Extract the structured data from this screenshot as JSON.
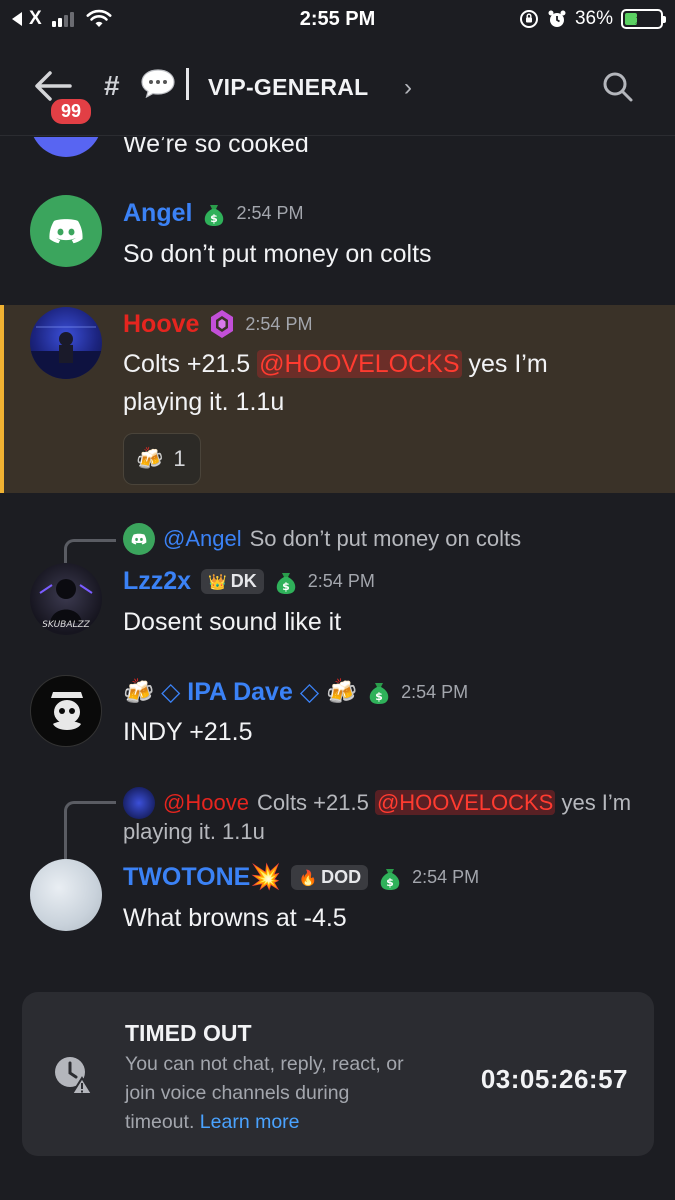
{
  "status_bar": {
    "carrier": "X",
    "time": "2:55 PM",
    "battery_percent": "36%",
    "battery_level": 0.36,
    "icons": [
      "back-to-app-icon",
      "signal-icon",
      "wifi-icon",
      "orientation-lock-icon",
      "alarm-icon",
      "battery-charging-icon"
    ]
  },
  "header": {
    "unread_count": "99",
    "channel_prefix": "#",
    "channel_name": "VIP-GENERAL",
    "chevron": "›",
    "icons": [
      "back-arrow-icon",
      "speech-bubble-icon",
      "search-icon"
    ]
  },
  "messages": [
    {
      "text": "We’re so cooked"
    },
    {
      "author": "Angel",
      "time": "2:54 PM",
      "text": "So don’t put money on colts",
      "badge_icon": "money-bag-icon"
    },
    {
      "author": "Hoove",
      "time": "2:54 PM",
      "badge_icon": "purple-gem-icon",
      "text_before": "Colts +21.5 ",
      "mention": "@HOOVELOCKS",
      "text_after": " yes I’m",
      "text_line2": "playing it. 1.1u",
      "reaction": {
        "emoji": "🍻",
        "count": "1"
      }
    },
    {
      "reply_to": {
        "author": "@Angel",
        "text": "So don’t put money on colts"
      },
      "author": "Lzz2x",
      "tag": "DK",
      "time": "2:54 PM",
      "text": "Dosent sound like it"
    },
    {
      "author": "IPA Dave",
      "prefix": "🍻 ◇",
      "suffix": "◇ 🍻",
      "time": "2:54 PM",
      "text": "INDY +21.5"
    },
    {
      "reply_to": {
        "author": "@Hoove",
        "text_before": "Colts +21.5 ",
        "mention": "@HOOVELOCKS",
        "text_after": " yes I’m",
        "text_line2": "playing it. 1.1u"
      },
      "author": "TWOTONE",
      "author_emoji": "💥",
      "tag": "DOD",
      "time": "2:54 PM",
      "text": "What browns at -4.5"
    }
  ],
  "timeout": {
    "title": "TIMED OUT",
    "desc_line1": "You can not chat, reply, react, or",
    "desc_line2": "join voice channels during",
    "desc_line3": "timeout. ",
    "link": "Learn more",
    "timer": "03:05:26:57",
    "icon": "clock-warning-icon"
  },
  "colors": {
    "background": "#1c1d22",
    "username_blue": "#3b82f6",
    "username_red": "#e5251f",
    "highlight_bg": "#3a3228",
    "highlight_bar": "#f0b232",
    "link": "#4aa3ff"
  }
}
